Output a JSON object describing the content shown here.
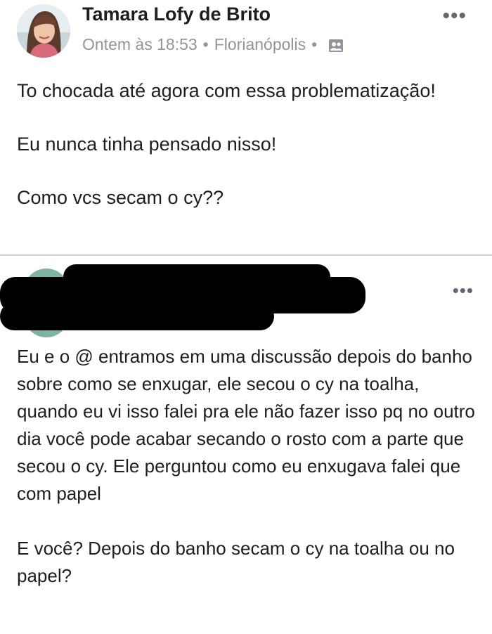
{
  "post": {
    "author": "Tamara Lofy de Brito",
    "timestamp": "Ontem às 18:53",
    "separator": "•",
    "location": "Florianópolis",
    "privacy_icon": "group-icon",
    "more_label": "•••",
    "paragraphs": [
      "To chocada até agora com essa problematização!",
      "Eu nunca tinha pensado nisso!",
      "Como vcs secam o cy??"
    ]
  },
  "shared_post": {
    "more_label": "•••",
    "paragraphs": [
      "Eu e o @ entramos em uma discussão depois do banho sobre como se enxugar, ele secou o cy na toalha, quando eu vi isso falei pra ele não fazer isso pq no outro dia você pode acabar secando o rosto com a parte que secou o cy. Ele perguntou como eu enxugava falei que com papel",
      "E você? Depois do banho secam o cy na toalha ou no papel?"
    ]
  }
}
